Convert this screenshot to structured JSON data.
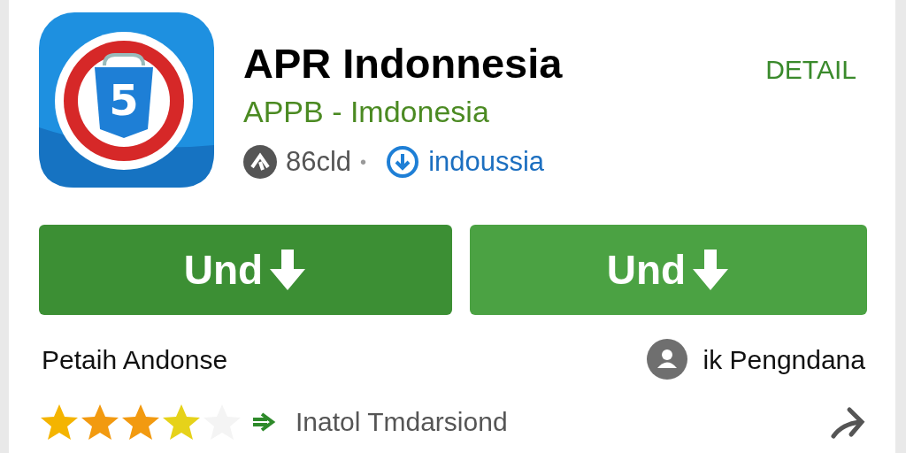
{
  "app": {
    "icon_glyph": "5",
    "title": "APR Indonnesia",
    "developer": "APPB - Imdonesia",
    "size": "86cld",
    "separator": "•",
    "source": "indoussia",
    "detail_link": "DETAIL"
  },
  "buttons": [
    {
      "label": "Und"
    },
    {
      "label": "Und"
    }
  ],
  "info": {
    "left": "Petaih Andonse",
    "right": "ik Pengndana"
  },
  "rating": {
    "stars": 4,
    "text": "Inatol Tmdarsiond"
  }
}
